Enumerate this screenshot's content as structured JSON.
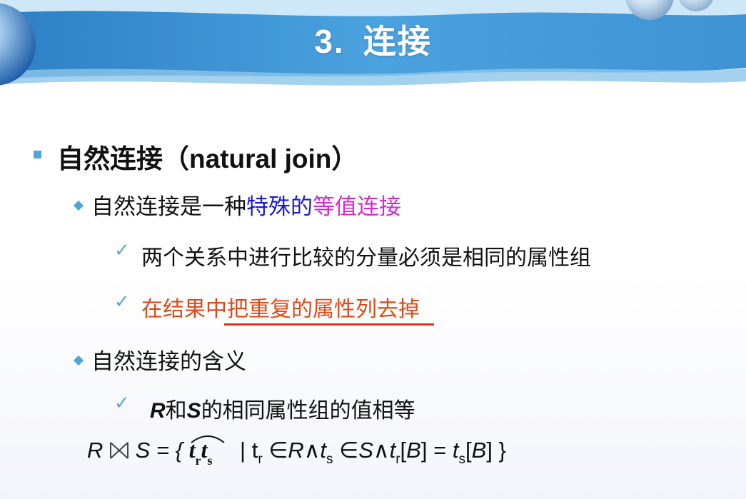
{
  "slide": {
    "title_num": "3.",
    "title_text": "连接",
    "level1": {
      "zh": "自然连接（",
      "en": "natural join",
      "close": "）"
    },
    "point1": {
      "text_a": "自然连接是一种",
      "text_b": "特殊的",
      "text_c": "等值连接"
    },
    "check1": "两个关系中进行比较的分量必须是相同的属性组",
    "check2": "在结果中把重复的属性列去掉",
    "point2": "自然连接的含义",
    "check3": {
      "r": "R",
      "and": "和",
      "s": "S",
      "rest": "的相同属性组的值相等"
    },
    "formula": {
      "lhs_r": "R",
      "lhs_s": "S = {",
      "t1": "t",
      "t1_sub": "r",
      "t2": "t",
      "t2_sub": "s",
      "bar": "|",
      "tr": "t",
      "tr_sub": "r",
      "in1": "∈",
      "r": "R",
      "and1": "∧",
      "ts": "t",
      "ts_sub": "s",
      "in2": "∈",
      "s": "S",
      "and2": "∧",
      "tr2": "t",
      "tr2_sub": "r",
      "b1": "[",
      "B1": "B",
      "b1c": "] =",
      "ts2": "t",
      "ts2_sub": "s",
      "b2": "[",
      "B2": "B",
      "b2c": "] }"
    },
    "colors": {
      "bullet": "#4fa4d8",
      "emph_blue": "#1a1ad0",
      "emph_magenta": "#d22ad2",
      "emph_orange": "#e04a17",
      "underline": "#d9301e"
    }
  }
}
